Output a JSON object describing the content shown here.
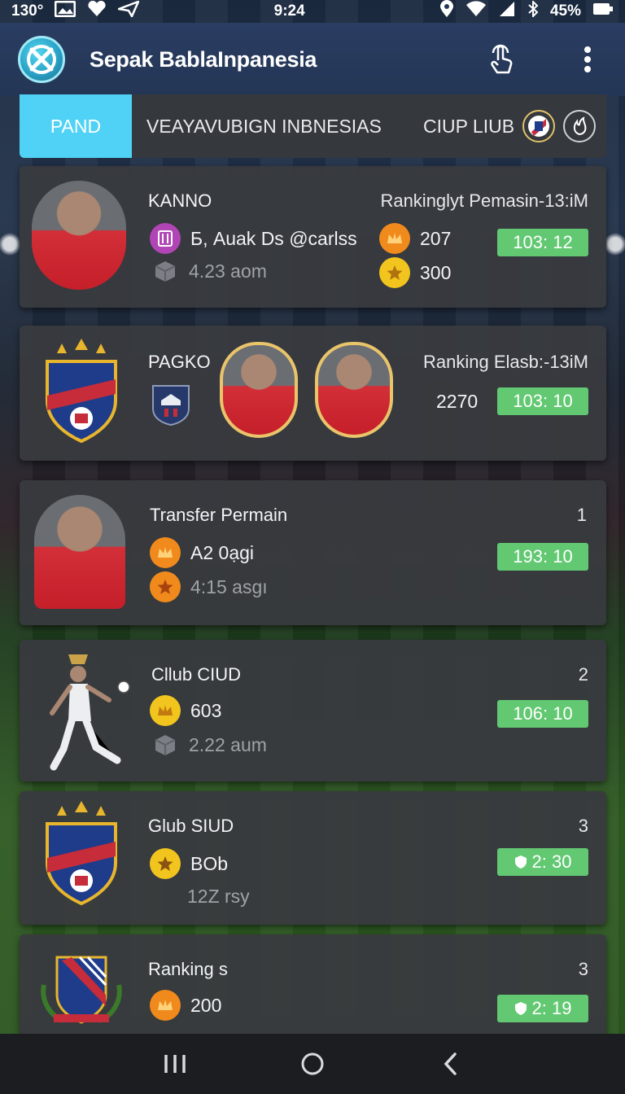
{
  "status_bar": {
    "left_text": "130°",
    "time": "9:24",
    "battery": "45%"
  },
  "app_bar": {
    "title": "Sepak BablaInpanesia",
    "icons": [
      "app-logo-icon",
      "touch-icon",
      "more-vert-icon"
    ]
  },
  "tabs": [
    {
      "label": "PAND",
      "active": true
    },
    {
      "label": "VEAYAVUBIGN INBNESIAS",
      "active": false
    },
    {
      "label": "CIUP LIUB",
      "active": false
    }
  ],
  "cards": [
    {
      "title": "KANNO",
      "subtitle": "Б, Auak Ds @carlss",
      "muted": "4.23 aom",
      "right_header": "Rankinglyt Pemasin-13:iM",
      "stat1": "207",
      "stat2": "300",
      "badge": "103: 12"
    },
    {
      "title": "PAGKO",
      "right_header": "Ranking Elasb:-13iM",
      "value": "2270",
      "badge": "103: 10"
    },
    {
      "title": "Transfer Permain",
      "line1": "A2 0ạgi",
      "line2": "4:15 asgı",
      "rank": "1",
      "badge": "193: 10"
    },
    {
      "title": "Cllub CIUD",
      "line1": "603",
      "muted": "2.22 aum",
      "rank": "2",
      "badge": "106: 10"
    },
    {
      "title": "Glub SIUD",
      "line1": "BOb",
      "muted": "12Z rsy",
      "rank": "3",
      "badge": "2: 30"
    },
    {
      "title": "Ranking s",
      "line1": "200",
      "rank": "3",
      "badge": "2: 19"
    }
  ],
  "colors": {
    "accent": "#4fd2f5",
    "badge_green": "#62c872",
    "card_bg": "#383a3e",
    "app_bar": "#2a3d62"
  }
}
